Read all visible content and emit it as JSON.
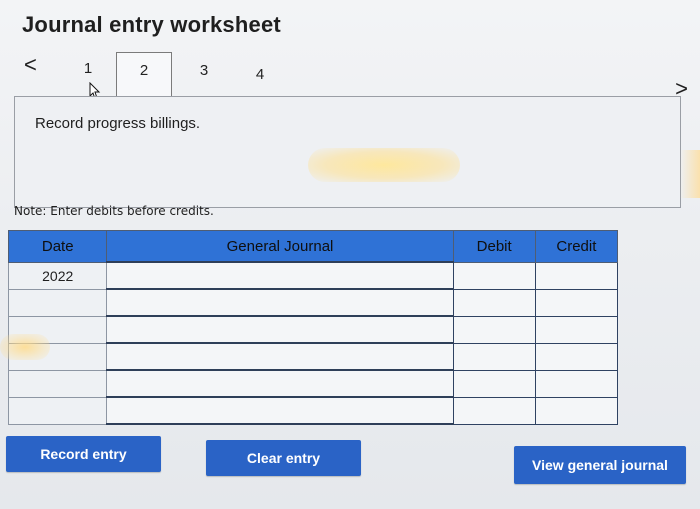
{
  "title": "Journal entry worksheet",
  "nav": {
    "prev_icon": "<",
    "next_icon": ">",
    "steps": [
      "1",
      "2",
      "3",
      "4"
    ],
    "active_step": "2"
  },
  "instruction": "Record progress billings.",
  "note": "Note: Enter debits before credits.",
  "table": {
    "headers": [
      "Date",
      "General Journal",
      "Debit",
      "Credit"
    ],
    "rows": [
      {
        "date": "2022",
        "account": "",
        "debit": "",
        "credit": ""
      },
      {
        "date": "",
        "account": "",
        "debit": "",
        "credit": ""
      },
      {
        "date": "",
        "account": "",
        "debit": "",
        "credit": ""
      },
      {
        "date": "",
        "account": "",
        "debit": "",
        "credit": ""
      },
      {
        "date": "",
        "account": "",
        "debit": "",
        "credit": ""
      },
      {
        "date": "",
        "account": "",
        "debit": "",
        "credit": ""
      }
    ]
  },
  "buttons": {
    "record": "Record entry",
    "clear": "Clear entry",
    "view": "View general journal"
  },
  "colors": {
    "header_blue": "#2f72d6",
    "button_blue": "#2a63c6"
  },
  "icons": {
    "cursor": "pointer-cursor-icon"
  }
}
